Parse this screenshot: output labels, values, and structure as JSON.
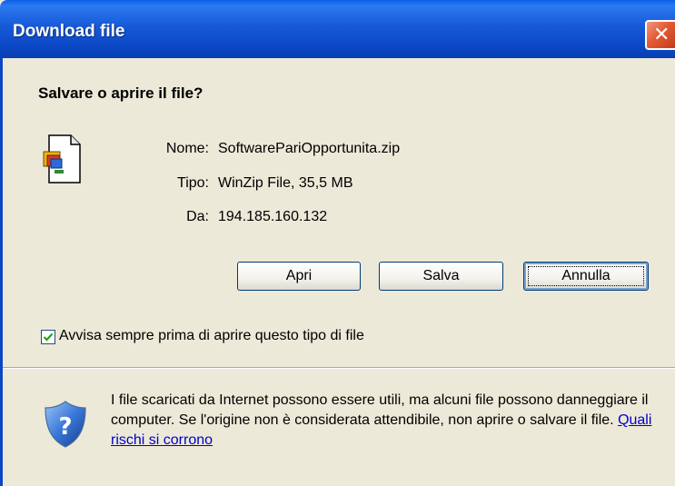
{
  "window": {
    "title": "Download file",
    "close_glyph": "✕"
  },
  "dialog": {
    "heading": "Salvare o aprire il file?",
    "file_icon": "zip-file-icon",
    "info": {
      "name_label": "Nome:",
      "name_value": "SoftwarePariOpportunita.zip",
      "type_label": "Tipo:",
      "type_value": "WinZip File, 35,5 MB",
      "from_label": "Da:",
      "from_value": "194.185.160.132"
    },
    "buttons": {
      "open": "Apri",
      "save": "Salva",
      "cancel": "Annulla"
    },
    "always_ask": {
      "label": "Avvisa sempre prima di aprire questo tipo di file",
      "checked": true
    },
    "warning": {
      "text": "I file scaricati da Internet possono essere utili, ma alcuni file possono danneggiare il computer. Se l'origine non è considerata attendibile, non aprire o salvare il file.",
      "link": "Quali rischi si corrono",
      "icon": "shield-icon"
    }
  },
  "colors": {
    "titlebar": "#0b47c4",
    "dialog_bg": "#ece9d8",
    "close_button": "#e25a34",
    "link": "#0000cc"
  }
}
